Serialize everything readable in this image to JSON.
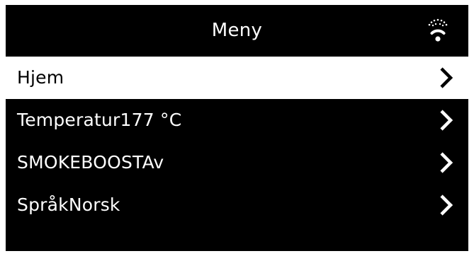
{
  "header": {
    "title": "Meny",
    "status_icon": "wifi-signal-icon"
  },
  "menu": {
    "items": [
      {
        "label": "Hjem",
        "selected": true,
        "icon": "chevron-right-icon"
      },
      {
        "label": "Temperatur177 °C",
        "selected": false,
        "icon": "chevron-right-icon"
      },
      {
        "label": "SMOKEBOOSTAv",
        "selected": false,
        "icon": "chevron-right-icon"
      },
      {
        "label": "SpråkNorsk",
        "selected": false,
        "icon": "chevron-right-icon"
      }
    ]
  },
  "colors": {
    "screen_background": "#000000",
    "text": "#ffffff",
    "selected_background": "#ffffff",
    "selected_text": "#000000"
  }
}
